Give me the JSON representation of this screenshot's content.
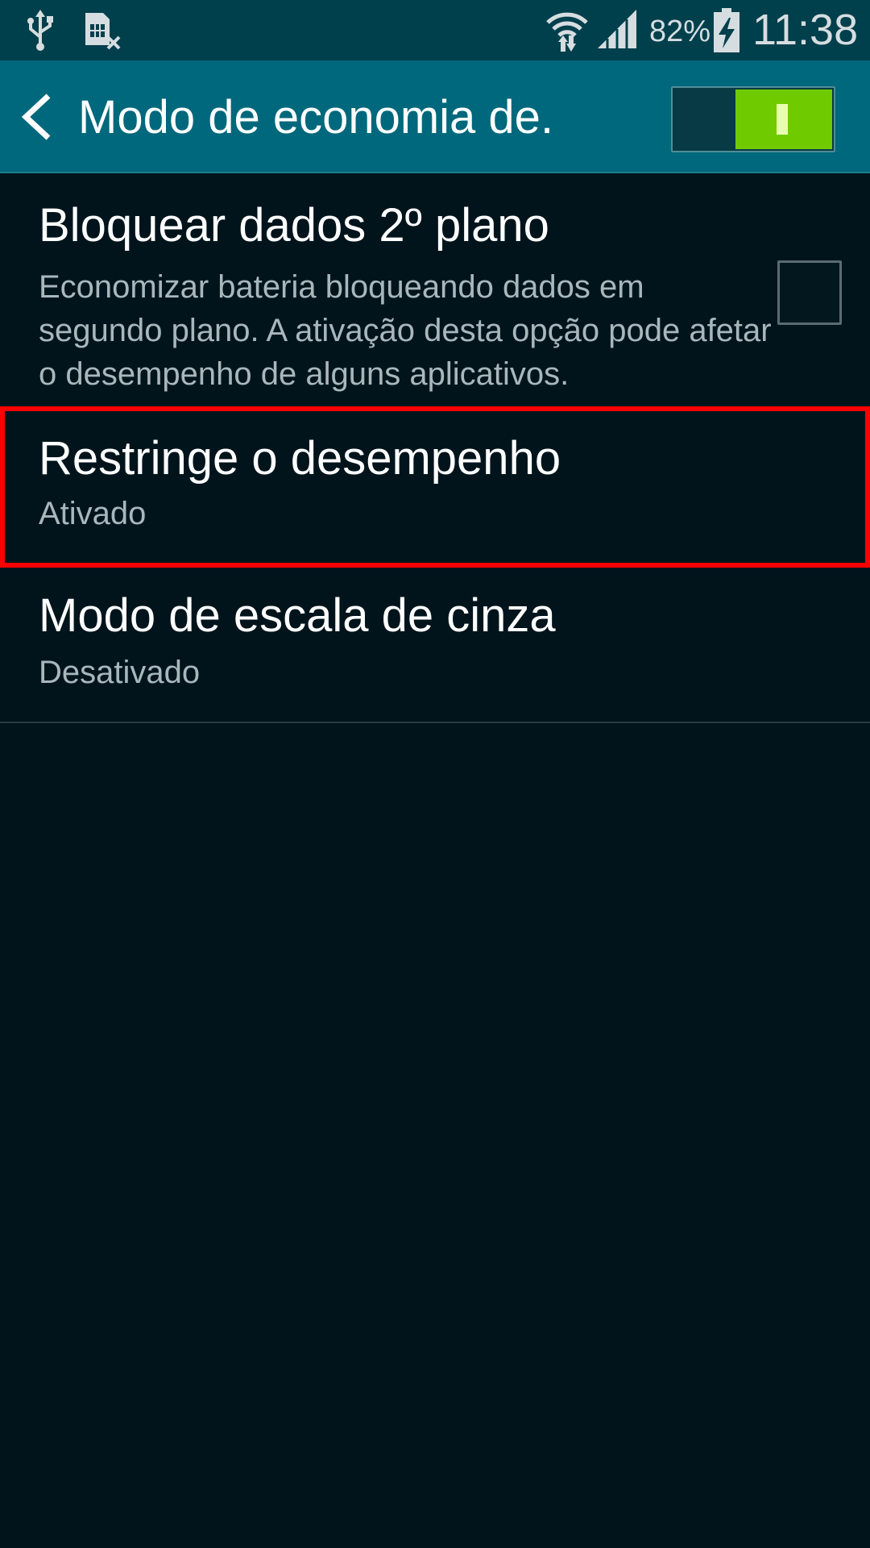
{
  "status_bar": {
    "icons_left": [
      "usb-icon",
      "sim-card-error-icon"
    ],
    "icons_right": [
      "wifi-icon",
      "signal-icon",
      "battery-charging-icon"
    ],
    "battery_percent": "82%",
    "time": "11:38"
  },
  "action_bar": {
    "title": "Modo de economia de.",
    "back_icon": "chevron-left-icon",
    "master_switch_on": true
  },
  "settings": {
    "items": [
      {
        "title": "Bloquear dados 2º plano",
        "subtitle": "Economizar bateria bloqueando dados em segundo plano. A ativação desta opção pode afetar o desempenho de alguns aplicativos.",
        "checked": false
      },
      {
        "title": "Restringe o desempenho",
        "subtitle": "Ativado"
      },
      {
        "title": "Modo de escala de cinza",
        "subtitle": "Desativado"
      }
    ]
  },
  "colors": {
    "status_bar": "#003f4c",
    "action_bar": "#00687c",
    "background": "#01141c",
    "switch_on": "#6fcb00",
    "highlight": "#ff0000"
  }
}
